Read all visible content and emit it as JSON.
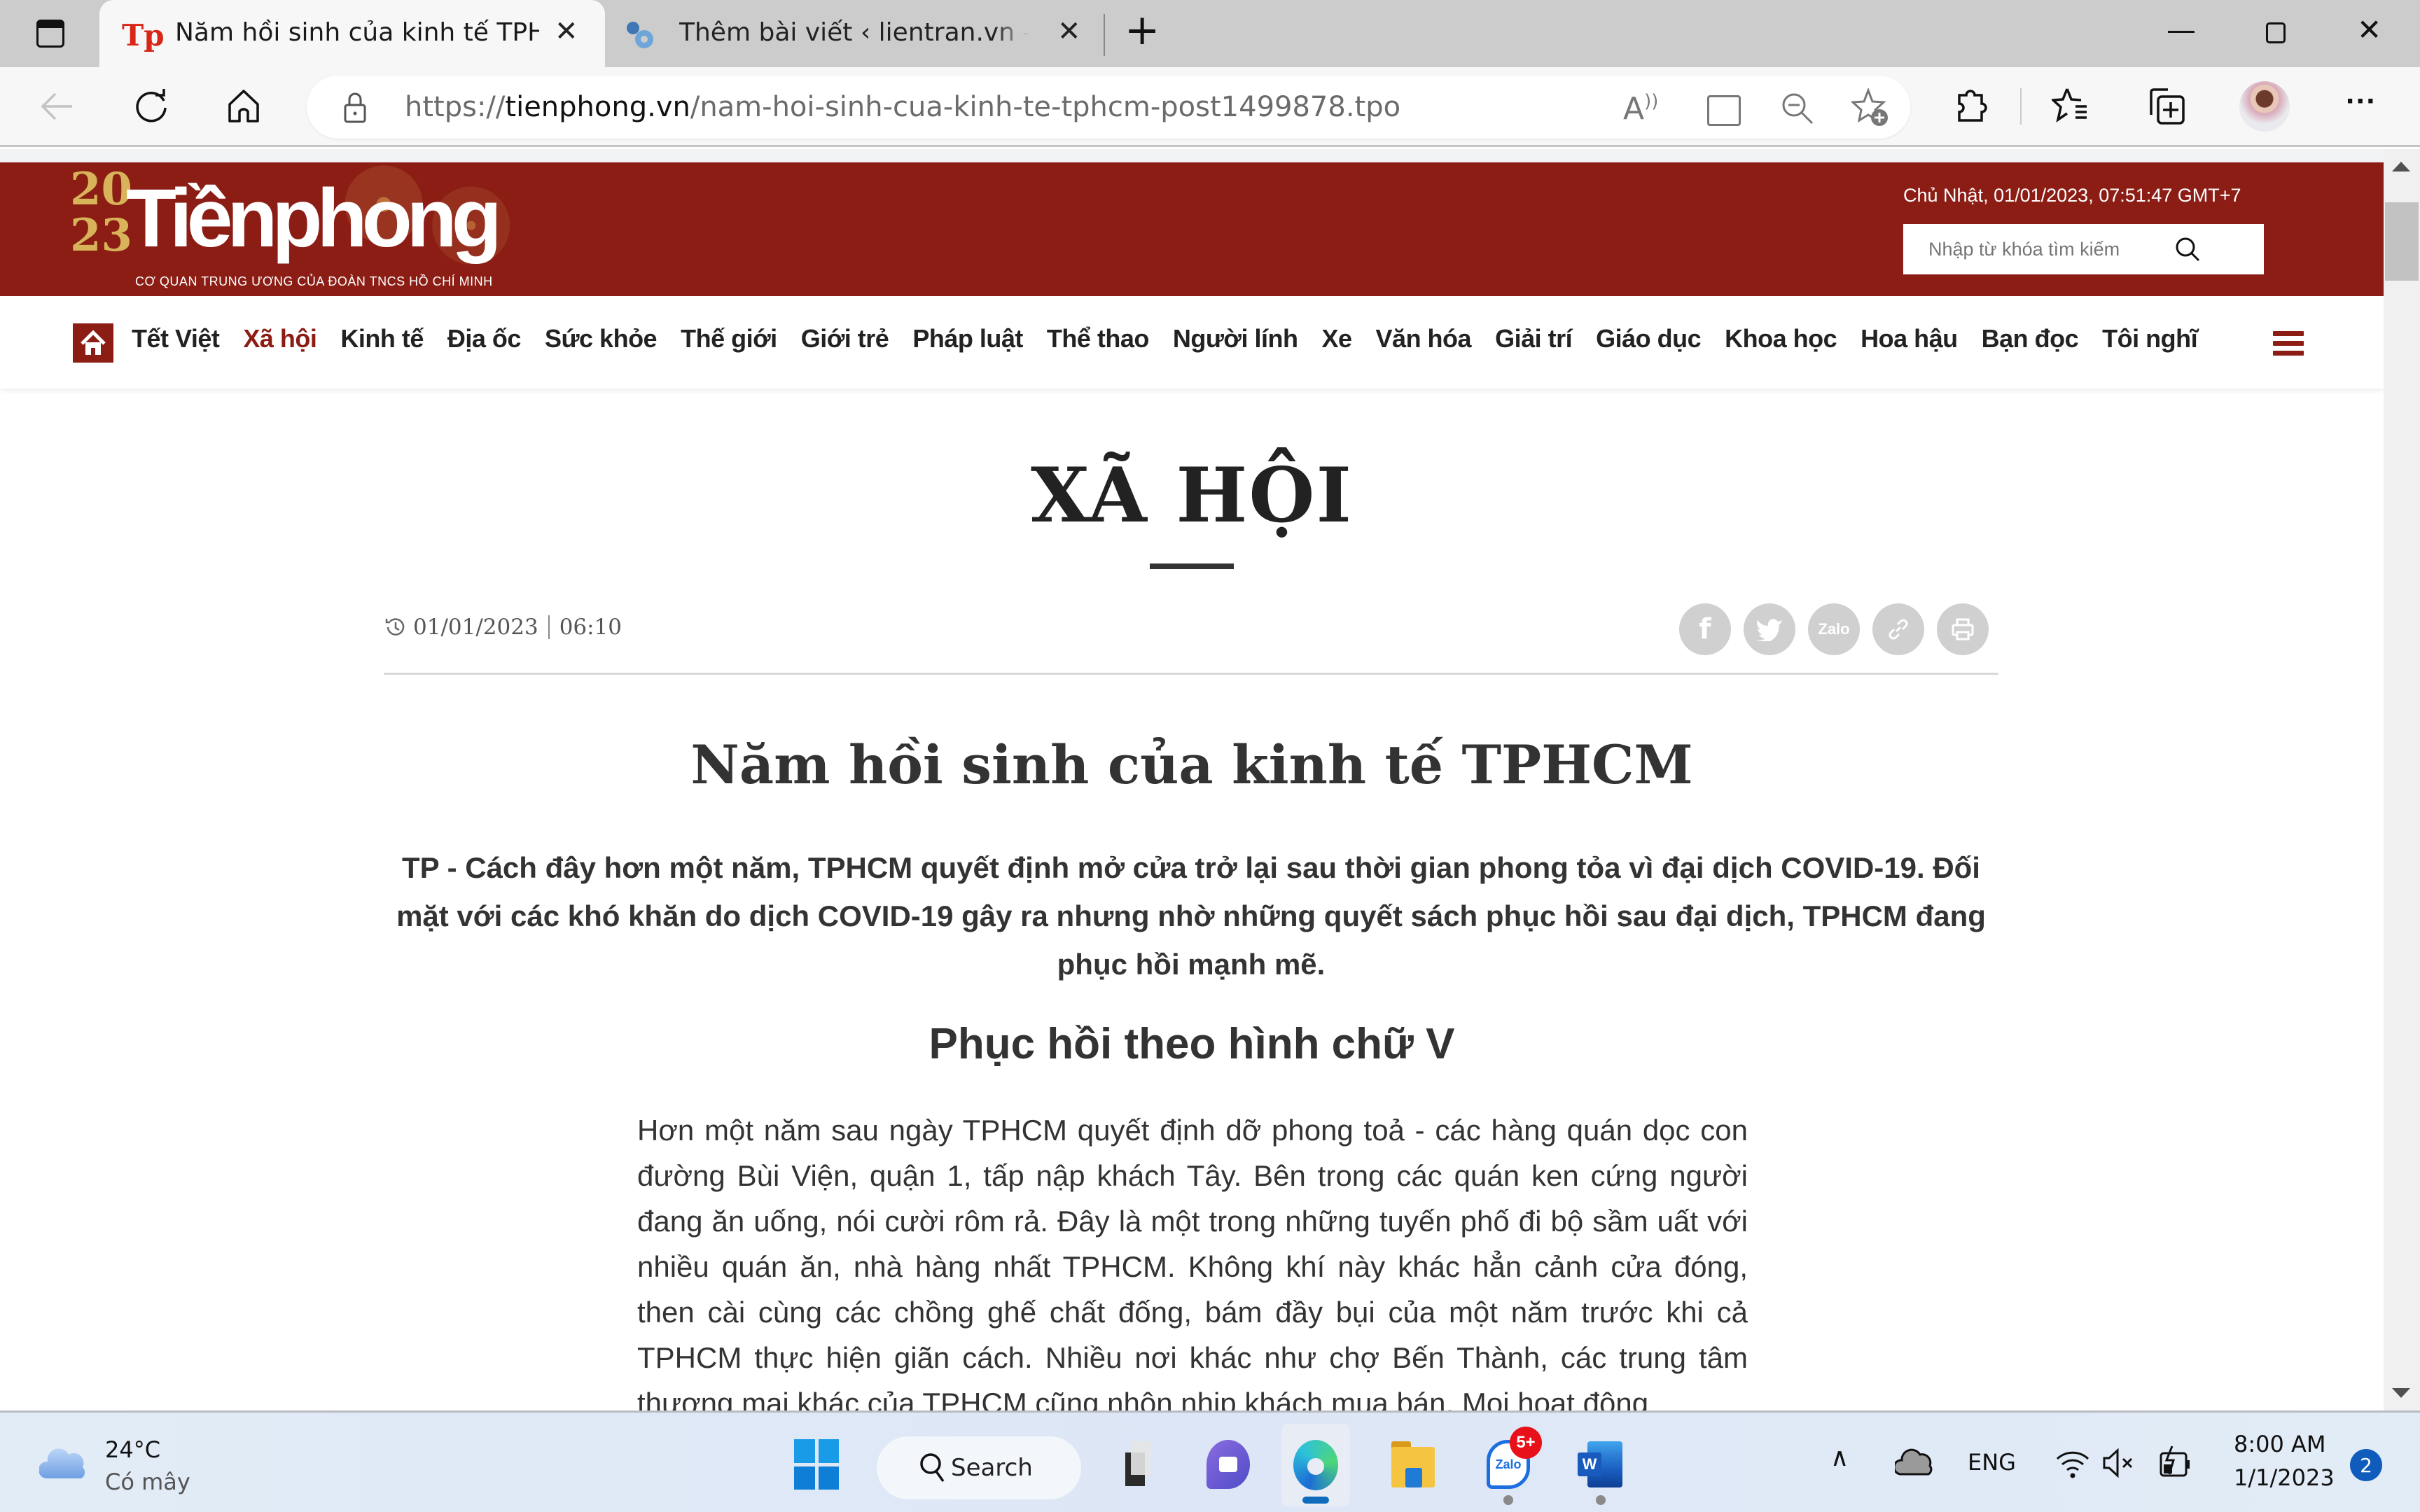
{
  "browser": {
    "tabs": [
      {
        "title": "Năm hồi sinh của kinh tế TPHCM",
        "active": true,
        "favicon": "tienphong-favicon"
      },
      {
        "title": "Thêm bài viết ‹ lientran.vn — WordPress",
        "active": false,
        "favicon": "wordpress-gear-favicon"
      }
    ],
    "new_tab_label": "+",
    "close_label": "✕",
    "url_prefix": "https://",
    "url_domain": "tienphong.vn",
    "url_path": "/nam-hoi-sinh-cua-kinh-te-tphcm-post1499878.tpo"
  },
  "site": {
    "logo_text": "Tiềnphong",
    "logo_year_top": "20",
    "logo_year_bottom": "23",
    "logo_subtitle": "CƠ QUAN TRUNG ƯƠNG CỦA ĐOÀN TNCS HỒ CHÍ MINH",
    "datetime": "Chủ Nhật, 01/01/2023, 07:51:47 GMT+7",
    "search_placeholder": "Nhập từ khóa tìm kiếm",
    "brand_color": "#8b1d15",
    "categories": [
      {
        "label": "Tết Việt",
        "active": false
      },
      {
        "label": "Xã hội",
        "active": true
      },
      {
        "label": "Kinh tế",
        "active": false
      },
      {
        "label": "Địa ốc",
        "active": false
      },
      {
        "label": "Sức khỏe",
        "active": false
      },
      {
        "label": "Thế giới",
        "active": false
      },
      {
        "label": "Giới trẻ",
        "active": false
      },
      {
        "label": "Pháp luật",
        "active": false
      },
      {
        "label": "Thể thao",
        "active": false
      },
      {
        "label": "Người lính",
        "active": false
      },
      {
        "label": "Xe",
        "active": false
      },
      {
        "label": "Văn hóa",
        "active": false
      },
      {
        "label": "Giải trí",
        "active": false
      },
      {
        "label": "Giáo dục",
        "active": false
      },
      {
        "label": "Khoa học",
        "active": false
      },
      {
        "label": "Hoa hậu",
        "active": false
      },
      {
        "label": "Bạn đọc",
        "active": false
      },
      {
        "label": "Tôi nghĩ",
        "active": false
      }
    ]
  },
  "article": {
    "section": "XÃ HỘI",
    "date": "01/01/2023",
    "time": "06:10",
    "share": [
      "facebook",
      "twitter",
      "Zalo",
      "copy-link",
      "print"
    ],
    "zalo_label": "Zalo",
    "headline": "Năm hồi sinh của kinh tế TPHCM",
    "sapo": "TP - Cách đây hơn một năm, TPHCM quyết định mở cửa trở lại sau thời gian phong tỏa vì đại dịch COVID-19. Đối mặt với các khó khăn do dịch COVID-19 gây ra nhưng nhờ những quyết sách phục hồi sau đại dịch, TPHCM đang phục hồi mạnh mẽ.",
    "subheading": "Phục hồi theo hình chữ V",
    "body": "Hơn một năm sau ngày TPHCM quyết định dỡ phong toả - các hàng quán dọc con đường Bùi Viện, quận 1, tấp nập khách Tây. Bên trong các quán ken cứng người đang ăn uống, nói cười rôm rả. Đây là một trong những tuyến phố đi bộ sầm uất với nhiều quán ăn, nhà hàng nhất TPHCM. Không khí này khác hẳn cảnh cửa đóng, then cài cùng các chồng ghế chất đống, bám đầy bụi của một năm trước khi cả TPHCM thực hiện giãn cách. Nhiều nơi khác như chợ Bến Thành, các trung tâm thương mại khác của TPHCM cũng nhộn nhịp khách mua bán. Mọi hoạt động"
  },
  "taskbar": {
    "weather_temp": "24°C",
    "weather_desc": "Có mây",
    "search_label": "Search",
    "zalo_badge": "5+",
    "language": "ENG",
    "time": "8:00 AM",
    "date": "1/1/2023",
    "notification_count": "2"
  }
}
